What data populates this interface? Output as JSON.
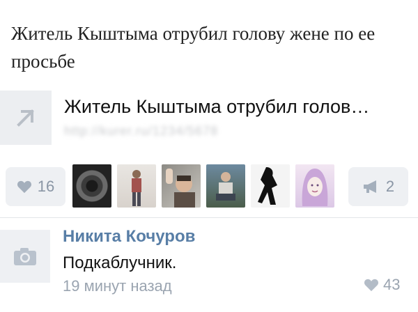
{
  "post": {
    "text": "Житель Кыштыма отрубил голову жене по ее просьбе"
  },
  "link": {
    "title": "Житель Кыштыма отрубил голов…",
    "url": "http://kurer.ru/1234/5678"
  },
  "likes": {
    "count": "16",
    "avatars": [
      "eye-avatar",
      "man-standing-avatar",
      "waving-man-avatar",
      "man-sitting-avatar",
      "silhouette-avatar",
      "drawn-girl-avatar"
    ]
  },
  "shares": {
    "count": "2"
  },
  "comment": {
    "author": "Никита Кочуров",
    "text": "Подкаблучник.",
    "time": "19 минут назад",
    "likes": "43"
  },
  "colors": {
    "accent": "#587ea6",
    "muted": "#9aa4b0",
    "button_bg": "#eef0f3"
  }
}
